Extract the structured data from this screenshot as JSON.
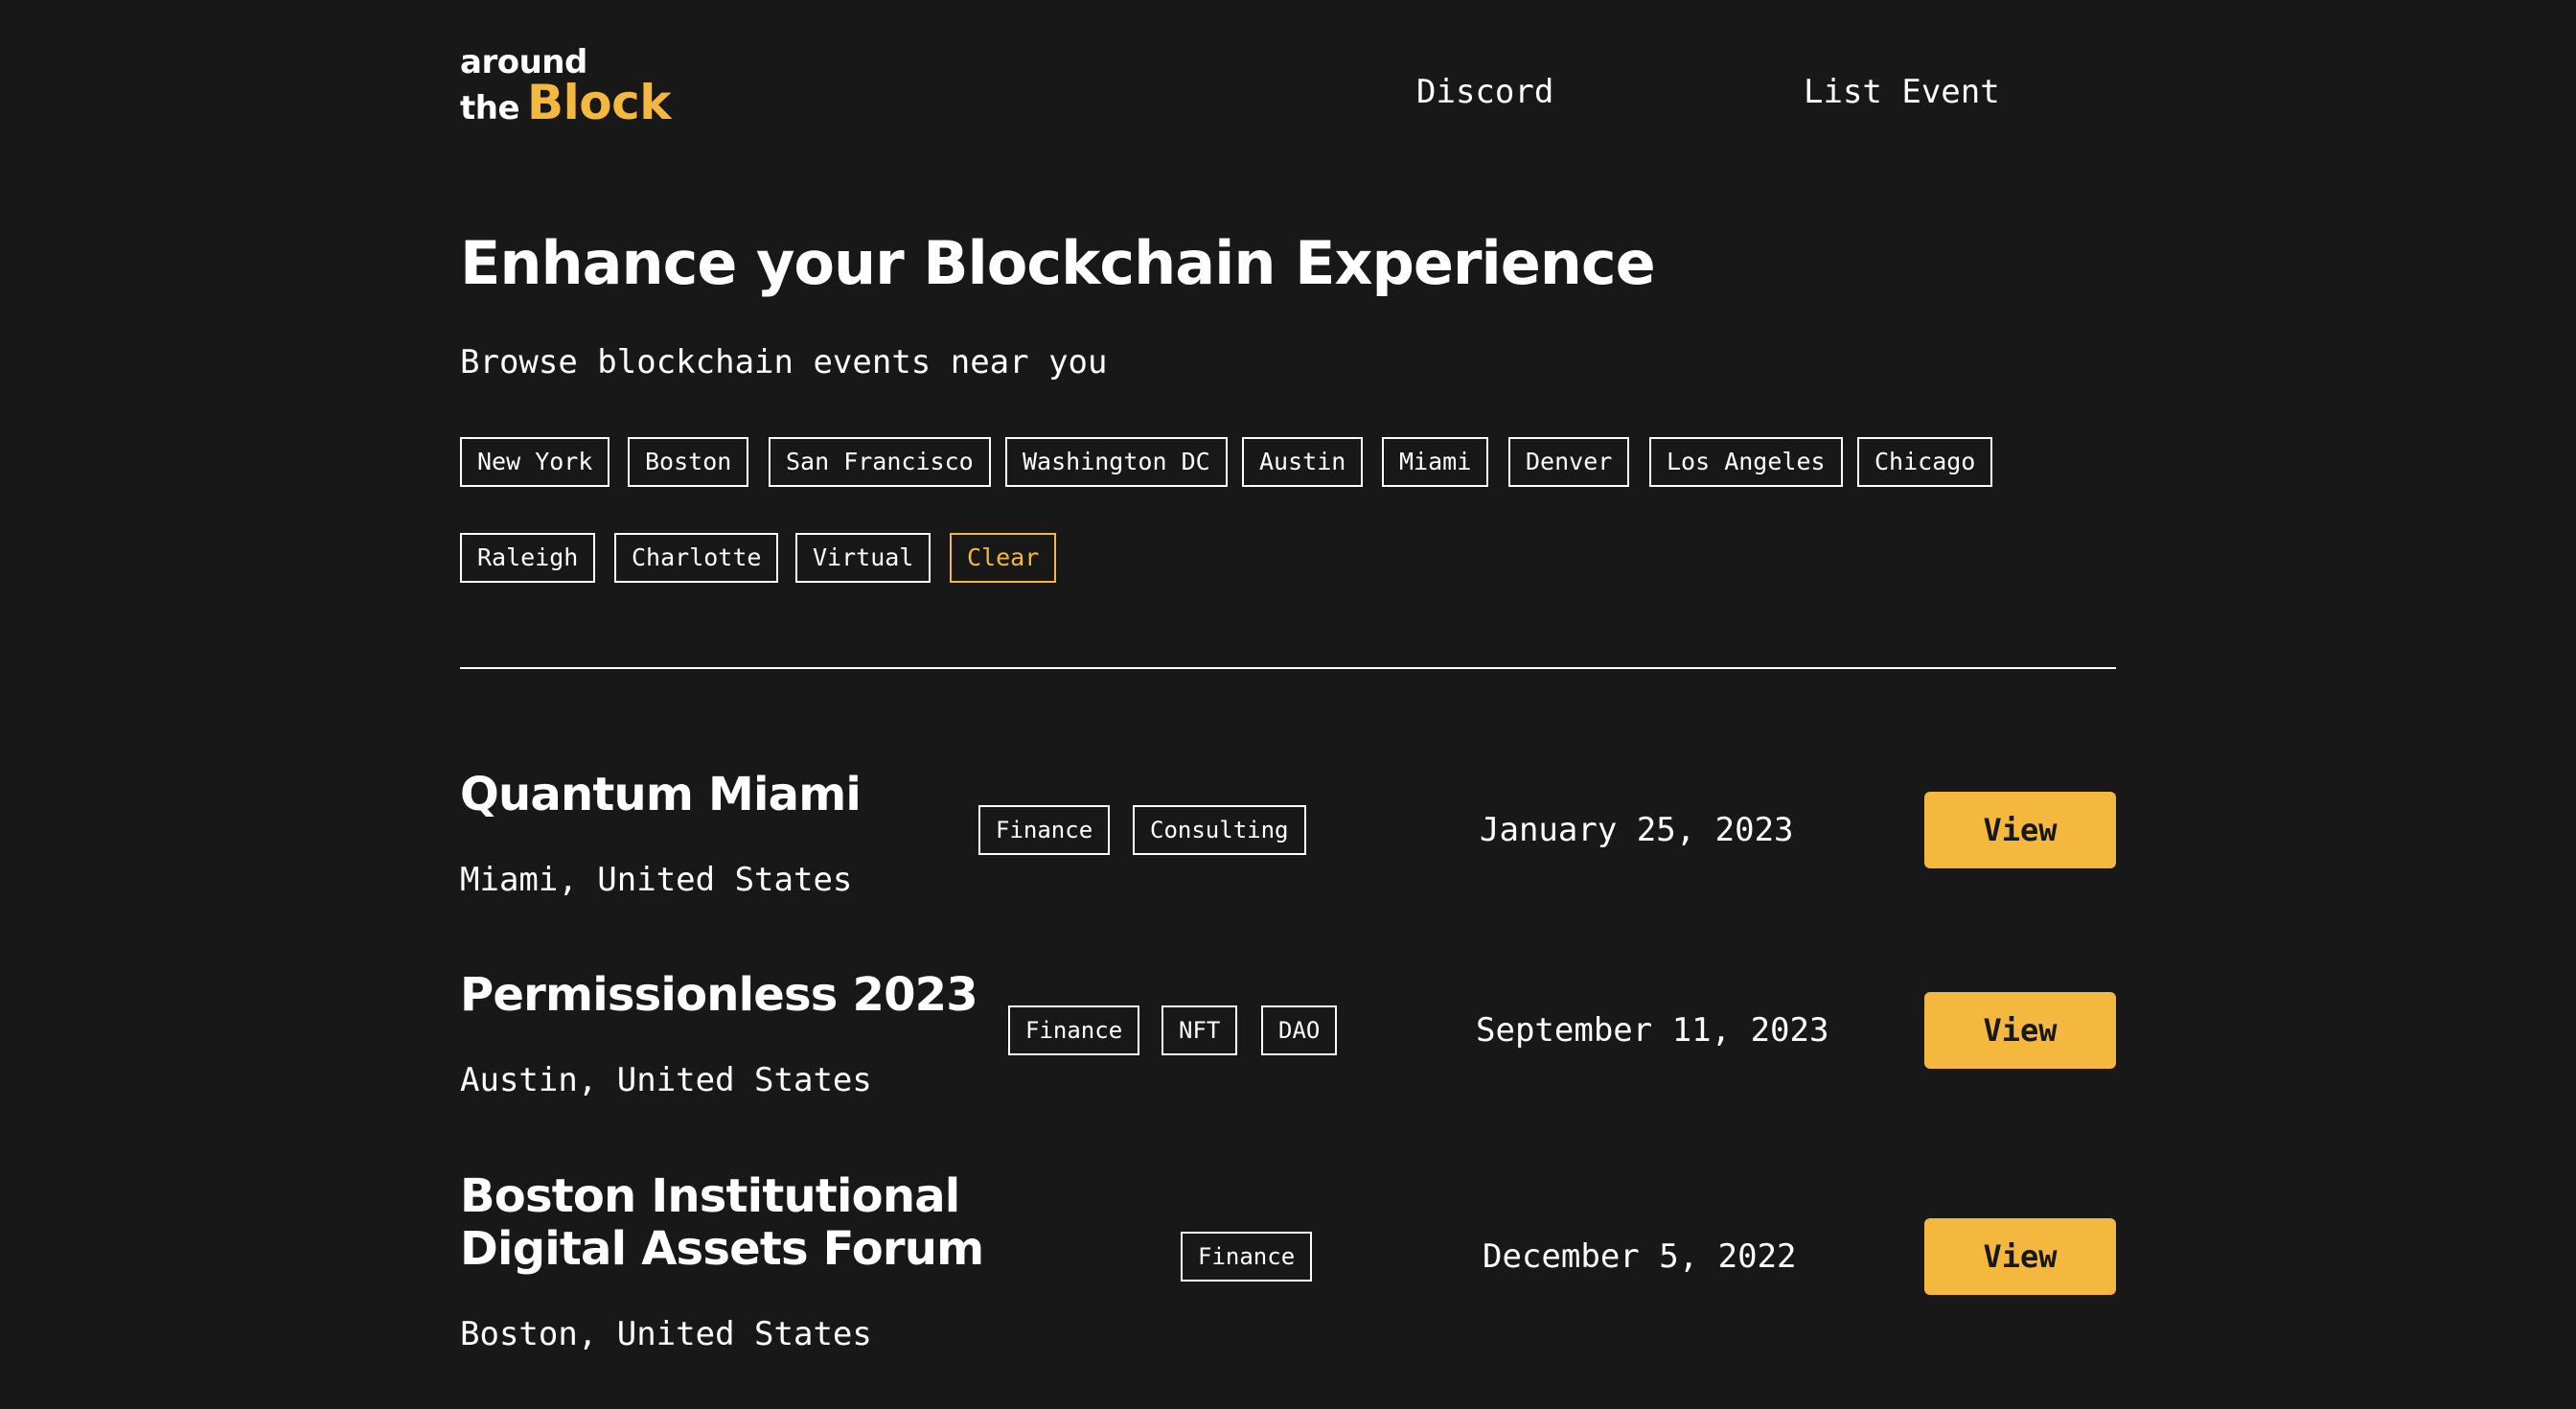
{
  "header": {
    "logo": {
      "line1": "around",
      "line2": "the",
      "highlight": "Block"
    },
    "nav": {
      "discord": "Discord",
      "list_event": "List Event"
    }
  },
  "hero": {
    "title": "Enhance your Blockchain Experience",
    "subtitle": "Browse blockchain events near you"
  },
  "filters": {
    "cities": [
      "New York",
      "Boston",
      "San Francisco",
      "Washington DC",
      "Austin",
      "Miami",
      "Denver",
      "Los Angeles",
      "Chicago",
      "Raleigh",
      "Charlotte",
      "Virtual"
    ],
    "clear_label": "Clear"
  },
  "events": [
    {
      "title": "Quantum Miami",
      "location": "Miami, United States",
      "tags": [
        "Finance",
        "Consulting"
      ],
      "date": "January 25, 2023",
      "button": "View"
    },
    {
      "title": "Permissionless 2023",
      "location": "Austin, United States",
      "tags": [
        "Finance",
        "NFT",
        "DAO"
      ],
      "date": "September 11, 2023",
      "button": "View"
    },
    {
      "title": "Boston Institutional Digital Assets Forum",
      "location": "Boston, United States",
      "tags": [
        "Finance"
      ],
      "date": "December 5, 2022",
      "button": "View"
    }
  ],
  "colors": {
    "background": "#181818",
    "accent": "#f5b83e",
    "text": "#ffffff"
  }
}
